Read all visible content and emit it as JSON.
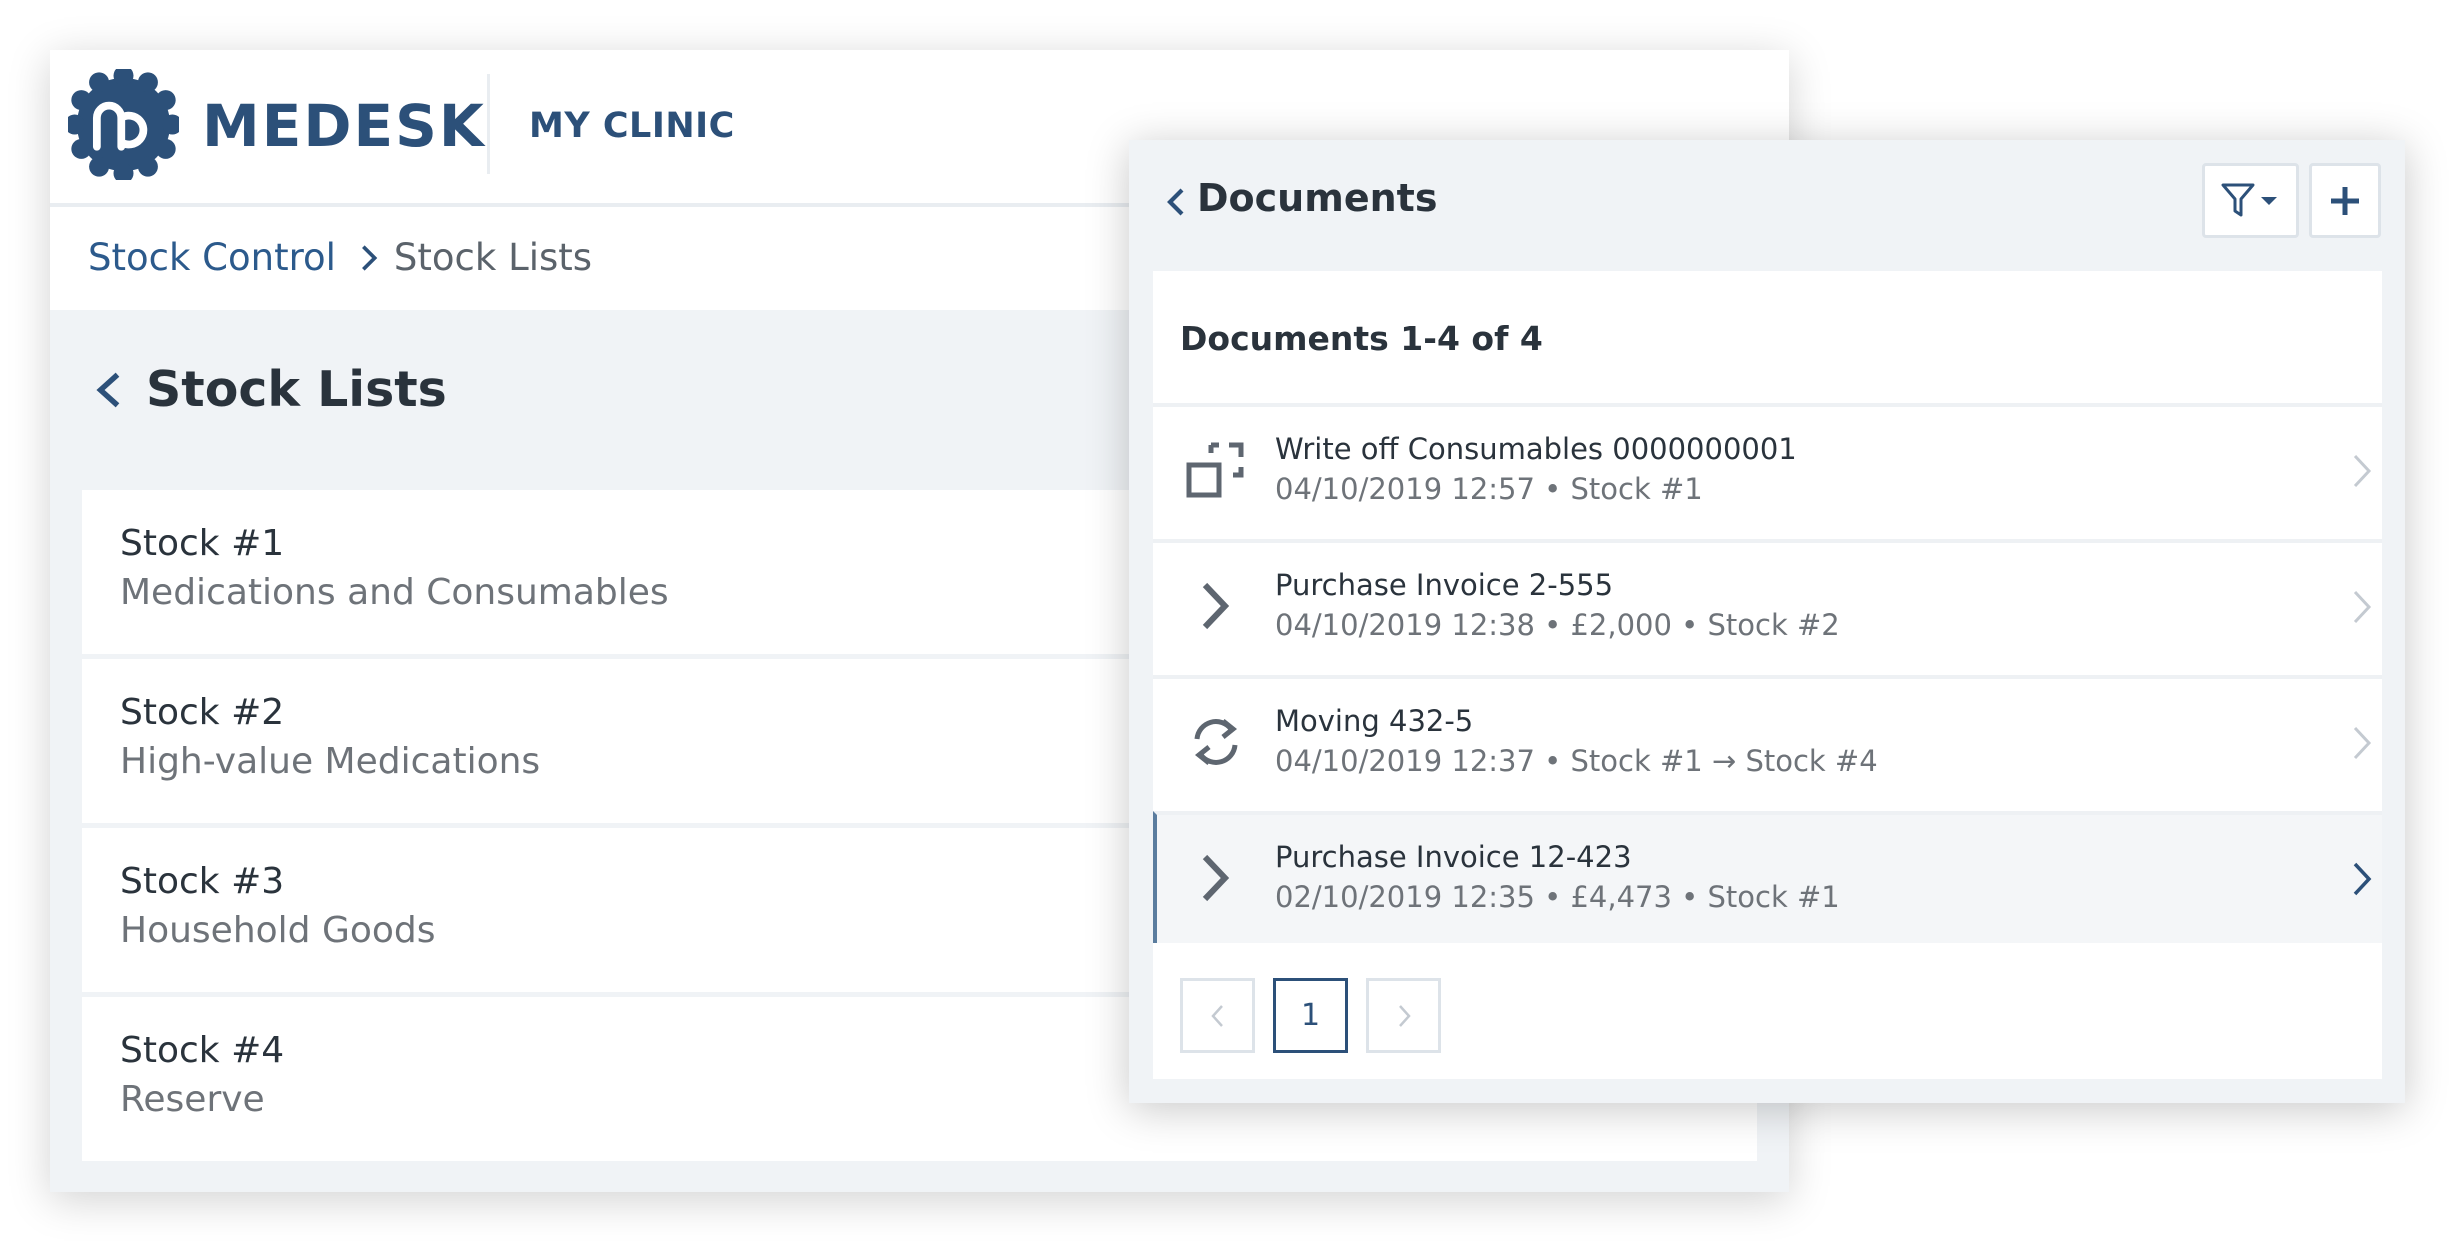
{
  "app": {
    "brand": "MEDESK",
    "clinic": "MY CLINIC",
    "colors": {
      "brand": "#2c5079",
      "link": "#2c5a8c",
      "background": "#f0f3f6"
    }
  },
  "breadcrumb": {
    "items": [
      {
        "label": "Stock Control"
      },
      {
        "label": "Stock Lists"
      }
    ]
  },
  "page": {
    "title": "Stock Lists"
  },
  "stocks": [
    {
      "name": "Stock #1",
      "description": "Medications and Consumables"
    },
    {
      "name": "Stock #2",
      "description": "High-value Medications"
    },
    {
      "name": "Stock #3",
      "description": "Household Goods"
    },
    {
      "name": "Stock #4",
      "description": "Reserve"
    }
  ],
  "documents_panel": {
    "title": "Documents",
    "filter_icon": "filter-icon",
    "add_icon": "plus-icon",
    "count_label": "Documents 1-4 of 4",
    "documents": [
      {
        "icon": "write-off-icon",
        "title": "Write off Consumables 0000000001",
        "meta": "04/10/2019 12:57 • Stock #1",
        "selected": false
      },
      {
        "icon": "incoming-icon",
        "title": "Purchase Invoice 2-555",
        "meta": "04/10/2019 12:38 • £2,000 • Stock #2",
        "selected": false
      },
      {
        "icon": "moving-icon",
        "title": "Moving 432-5",
        "meta": "04/10/2019 12:37 • Stock #1 → Stock #4",
        "selected": false
      },
      {
        "icon": "incoming-icon",
        "title": "Purchase Invoice 12-423",
        "meta": "02/10/2019 12:35 • £4,473 • Stock #1",
        "selected": true
      }
    ],
    "pagination": {
      "prev": "<",
      "current": "1",
      "next": ">"
    }
  }
}
